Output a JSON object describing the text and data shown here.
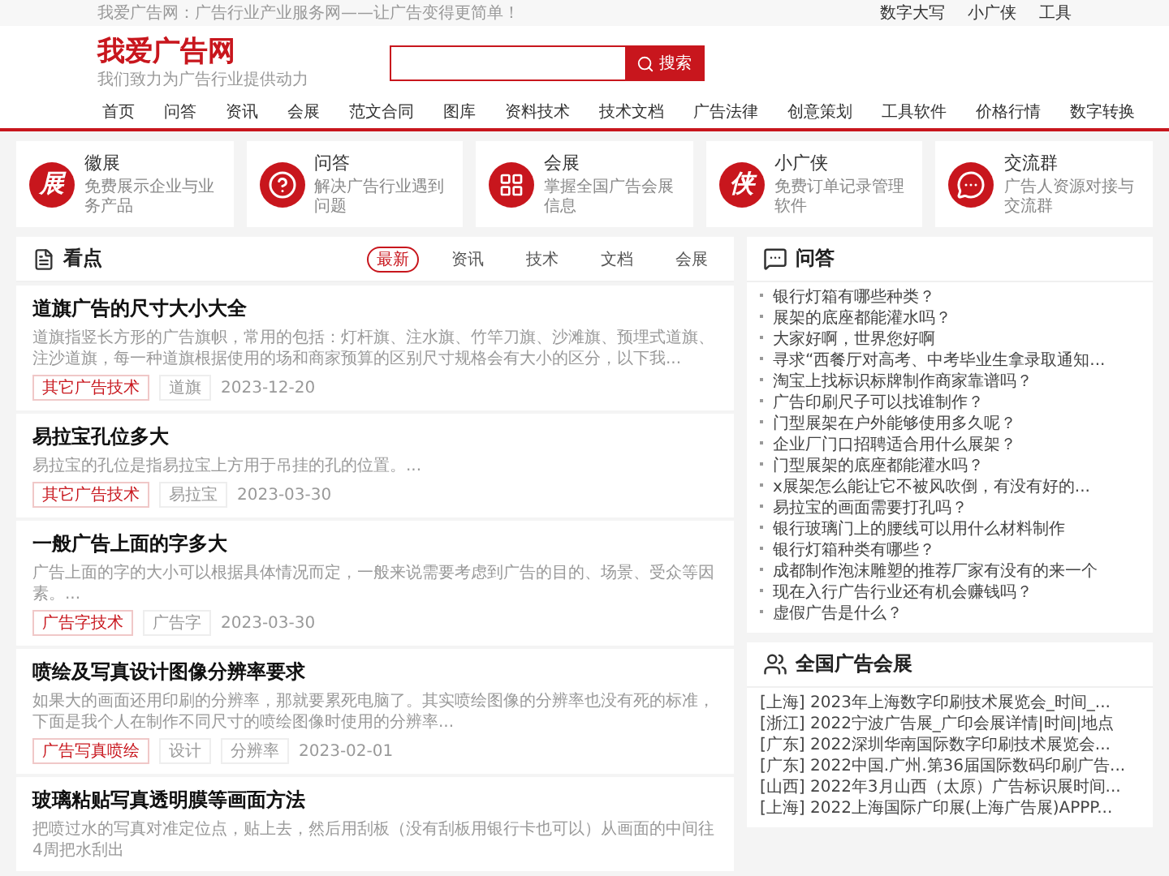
{
  "top_bar": {
    "slogan": "我爱广告网：广告行业产业服务网——让广告变得更简单！",
    "links": [
      "数字大写",
      "小广侠",
      "工具"
    ]
  },
  "header": {
    "logo": "我爱广告网",
    "tagline": "我们致力为广告行业提供动力",
    "search": {
      "button": "搜索"
    }
  },
  "nav": [
    "首页",
    "问答",
    "资讯",
    "会展",
    "范文合同",
    "图库",
    "资料技术",
    "技术文档",
    "广告法律",
    "创意策划",
    "工具软件",
    "价格行情",
    "数字转换"
  ],
  "features": [
    {
      "kind": "glyph",
      "glyph": "展",
      "title": "徽展",
      "desc": "免费展示企业与业务产品"
    },
    {
      "kind": "question",
      "title": "问答",
      "desc": "解决广告行业遇到问题"
    },
    {
      "kind": "expo",
      "title": "会展",
      "desc": "掌握全国广告会展信息"
    },
    {
      "kind": "glyph",
      "glyph": "侠",
      "title": "小广侠",
      "desc": "免费订单记录管理软件"
    },
    {
      "kind": "chat",
      "title": "交流群",
      "desc": "广告人资源对接与交流群"
    }
  ],
  "news": {
    "title": "看点",
    "tabs": [
      {
        "label": "最新",
        "selected": true
      },
      {
        "label": "资讯",
        "selected": false
      },
      {
        "label": "技术",
        "selected": false
      },
      {
        "label": "文档",
        "selected": false
      },
      {
        "label": "会展",
        "selected": false
      }
    ],
    "articles": [
      {
        "title": "道旗广告的尺寸大小大全",
        "excerpt": "道旗指竖长方形的广告旗帜，常用的包括：灯杆旗、注水旗、竹竿刀旗、沙滩旗、预埋式道旗、注沙道旗，每一种道旗根据使用的场和商家预算的区别尺寸规格会有大小的区分，以下我...",
        "category": "其它广告技术",
        "tags": [
          "道旗"
        ],
        "date": "2023-12-20"
      },
      {
        "title": "易拉宝孔位多大",
        "excerpt": "易拉宝的孔位是指易拉宝上方用于吊挂的孔的位置。...",
        "category": "其它广告技术",
        "tags": [
          "易拉宝"
        ],
        "date": "2023-03-30"
      },
      {
        "title": "一般广告上面的字多大",
        "excerpt": "广告上面的字的大小可以根据具体情况而定，一般来说需要考虑到广告的目的、场景、受众等因素。...",
        "category": "广告字技术",
        "tags": [
          "广告字"
        ],
        "date": "2023-03-30"
      },
      {
        "title": "喷绘及写真设计图像分辨率要求",
        "excerpt": "如果大的画面还用印刷的分辨率，那就要累死电脑了。其实喷绘图像的分辨率也没有死的标准，下面是我个人在制作不同尺寸的喷绘图像时使用的分辨率...",
        "category": "广告写真喷绘",
        "tags": [
          "设计",
          "分辨率"
        ],
        "date": "2023-02-01"
      },
      {
        "title": "玻璃粘贴写真透明膜等画面方法",
        "excerpt": "把喷过水的写真对准定位点，贴上去，然后用刮板（没有刮板用银行卡也可以）从画面的中间往4周把水刮出"
      }
    ]
  },
  "qa": {
    "title": "问答",
    "items": [
      "银行灯箱有哪些种类？",
      "展架的底座都能灌水吗？",
      "大家好啊，世界您好啊",
      "寻求“西餐厅对高考、中考毕业生拿录取通知...",
      "淘宝上找标识标牌制作商家靠谱吗？",
      "广告印刷尺子可以找谁制作？",
      "门型展架在户外能够使用多久呢？",
      "企业厂门口招聘适合用什么展架？",
      "门型展架的底座都能灌水吗？",
      "x展架怎么能让它不被风吹倒，有没有好的...",
      "易拉宝的画面需要打孔吗？",
      "银行玻璃门上的腰线可以用什么材料制作",
      "银行灯箱种类有哪些？",
      "成都制作泡沫雕塑的推荐厂家有没有的来一个",
      "现在入行广告行业还有机会赚钱吗？",
      "虚假广告是什么？"
    ]
  },
  "expos": {
    "title": "全国广告会展",
    "items": [
      "[上海] 2023年上海数字印刷技术展览会_时间_...",
      "[浙江] 2022宁波广告展_广印会展详情|时间|地点",
      "[广东] 2022深圳华南国际数字印刷技术展览会...",
      "[广东] 2022中国.广州.第36届国际数码印刷广告...",
      "[山西] 2022年3月山西（太原）广告标识展时间...",
      "[上海] 2022上海国际广印展(上海广告展)APPP..."
    ]
  }
}
